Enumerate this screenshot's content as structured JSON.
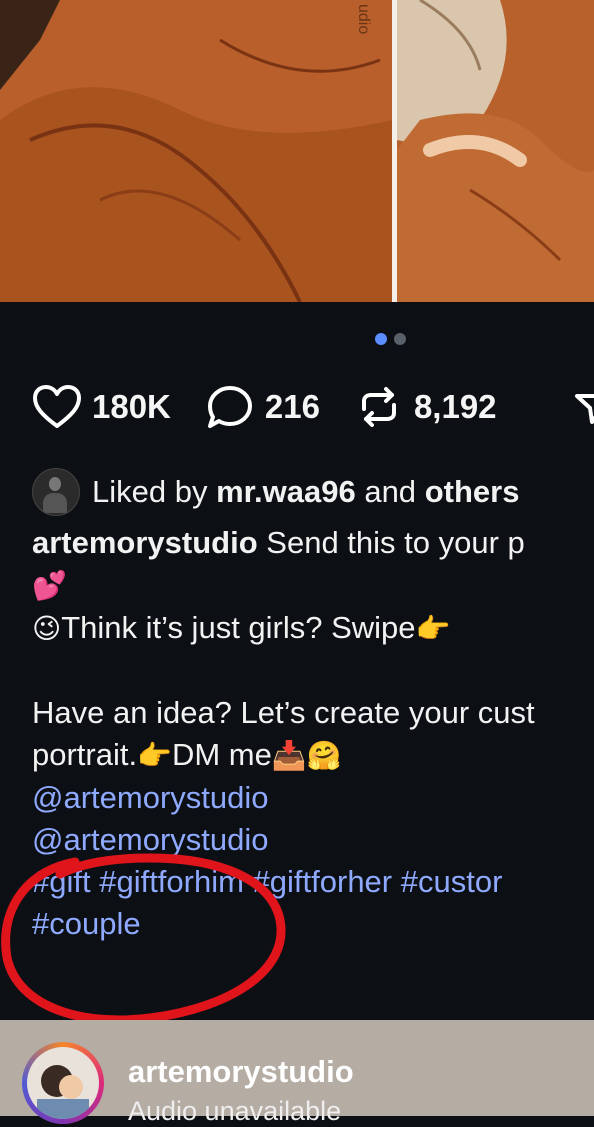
{
  "post": {
    "watermark": "udio",
    "carousel": {
      "count": 2,
      "active_index": 0
    },
    "stats": {
      "likes": "180K",
      "comments": "216",
      "reposts": "8,192"
    },
    "liked_by": {
      "prefix": "Liked by",
      "user": "mr.waa96",
      "middle": "and",
      "suffix": "others"
    },
    "caption": {
      "username": "artemorystudio",
      "line1": "Send this to your p",
      "line2_emoji": "💕",
      "line3_emoji": "😉",
      "line3_text": "Think it’s just girls? Swipe",
      "line3_emoji_end": "👉",
      "line4": "Have an idea? Let’s create your cust",
      "line5_text": "portrait.",
      "line5_emoji1": "👉",
      "line5_text2": "DM me",
      "line5_emoji2": "📥",
      "line5_emoji3": "🤗",
      "mention1": "@artemorystudio",
      "mention2": "@artemorystudio",
      "hashtags1": "#gift #giftforhim #giftforher #custor",
      "hashtags2": "#couple"
    }
  },
  "annotation": {
    "color": "#e0141b"
  },
  "audio_bar": {
    "username": "artemorystudio",
    "status": "Audio unavailable"
  },
  "icons": [
    "heart-icon",
    "comment-icon",
    "repost-icon",
    "share-icon"
  ]
}
